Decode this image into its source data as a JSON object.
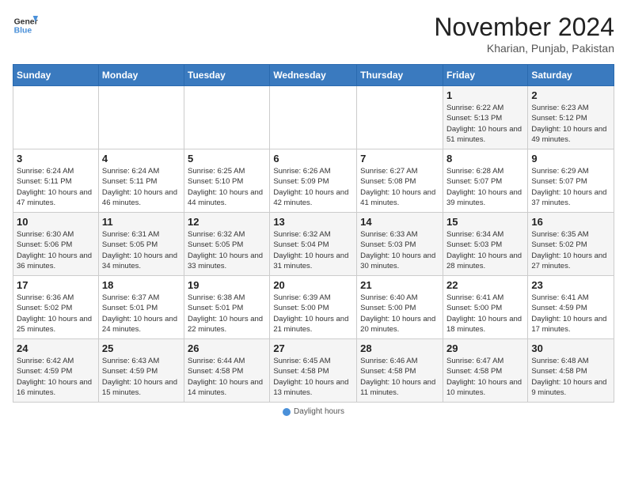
{
  "header": {
    "logo_line1": "General",
    "logo_line2": "Blue",
    "month_year": "November 2024",
    "location": "Kharian, Punjab, Pakistan"
  },
  "days_of_week": [
    "Sunday",
    "Monday",
    "Tuesday",
    "Wednesday",
    "Thursday",
    "Friday",
    "Saturday"
  ],
  "weeks": [
    [
      {
        "day": "",
        "info": ""
      },
      {
        "day": "",
        "info": ""
      },
      {
        "day": "",
        "info": ""
      },
      {
        "day": "",
        "info": ""
      },
      {
        "day": "",
        "info": ""
      },
      {
        "day": "1",
        "info": "Sunrise: 6:22 AM\nSunset: 5:13 PM\nDaylight: 10 hours and 51 minutes."
      },
      {
        "day": "2",
        "info": "Sunrise: 6:23 AM\nSunset: 5:12 PM\nDaylight: 10 hours and 49 minutes."
      }
    ],
    [
      {
        "day": "3",
        "info": "Sunrise: 6:24 AM\nSunset: 5:11 PM\nDaylight: 10 hours and 47 minutes."
      },
      {
        "day": "4",
        "info": "Sunrise: 6:24 AM\nSunset: 5:11 PM\nDaylight: 10 hours and 46 minutes."
      },
      {
        "day": "5",
        "info": "Sunrise: 6:25 AM\nSunset: 5:10 PM\nDaylight: 10 hours and 44 minutes."
      },
      {
        "day": "6",
        "info": "Sunrise: 6:26 AM\nSunset: 5:09 PM\nDaylight: 10 hours and 42 minutes."
      },
      {
        "day": "7",
        "info": "Sunrise: 6:27 AM\nSunset: 5:08 PM\nDaylight: 10 hours and 41 minutes."
      },
      {
        "day": "8",
        "info": "Sunrise: 6:28 AM\nSunset: 5:07 PM\nDaylight: 10 hours and 39 minutes."
      },
      {
        "day": "9",
        "info": "Sunrise: 6:29 AM\nSunset: 5:07 PM\nDaylight: 10 hours and 37 minutes."
      }
    ],
    [
      {
        "day": "10",
        "info": "Sunrise: 6:30 AM\nSunset: 5:06 PM\nDaylight: 10 hours and 36 minutes."
      },
      {
        "day": "11",
        "info": "Sunrise: 6:31 AM\nSunset: 5:05 PM\nDaylight: 10 hours and 34 minutes."
      },
      {
        "day": "12",
        "info": "Sunrise: 6:32 AM\nSunset: 5:05 PM\nDaylight: 10 hours and 33 minutes."
      },
      {
        "day": "13",
        "info": "Sunrise: 6:32 AM\nSunset: 5:04 PM\nDaylight: 10 hours and 31 minutes."
      },
      {
        "day": "14",
        "info": "Sunrise: 6:33 AM\nSunset: 5:03 PM\nDaylight: 10 hours and 30 minutes."
      },
      {
        "day": "15",
        "info": "Sunrise: 6:34 AM\nSunset: 5:03 PM\nDaylight: 10 hours and 28 minutes."
      },
      {
        "day": "16",
        "info": "Sunrise: 6:35 AM\nSunset: 5:02 PM\nDaylight: 10 hours and 27 minutes."
      }
    ],
    [
      {
        "day": "17",
        "info": "Sunrise: 6:36 AM\nSunset: 5:02 PM\nDaylight: 10 hours and 25 minutes."
      },
      {
        "day": "18",
        "info": "Sunrise: 6:37 AM\nSunset: 5:01 PM\nDaylight: 10 hours and 24 minutes."
      },
      {
        "day": "19",
        "info": "Sunrise: 6:38 AM\nSunset: 5:01 PM\nDaylight: 10 hours and 22 minutes."
      },
      {
        "day": "20",
        "info": "Sunrise: 6:39 AM\nSunset: 5:00 PM\nDaylight: 10 hours and 21 minutes."
      },
      {
        "day": "21",
        "info": "Sunrise: 6:40 AM\nSunset: 5:00 PM\nDaylight: 10 hours and 20 minutes."
      },
      {
        "day": "22",
        "info": "Sunrise: 6:41 AM\nSunset: 5:00 PM\nDaylight: 10 hours and 18 minutes."
      },
      {
        "day": "23",
        "info": "Sunrise: 6:41 AM\nSunset: 4:59 PM\nDaylight: 10 hours and 17 minutes."
      }
    ],
    [
      {
        "day": "24",
        "info": "Sunrise: 6:42 AM\nSunset: 4:59 PM\nDaylight: 10 hours and 16 minutes."
      },
      {
        "day": "25",
        "info": "Sunrise: 6:43 AM\nSunset: 4:59 PM\nDaylight: 10 hours and 15 minutes."
      },
      {
        "day": "26",
        "info": "Sunrise: 6:44 AM\nSunset: 4:58 PM\nDaylight: 10 hours and 14 minutes."
      },
      {
        "day": "27",
        "info": "Sunrise: 6:45 AM\nSunset: 4:58 PM\nDaylight: 10 hours and 13 minutes."
      },
      {
        "day": "28",
        "info": "Sunrise: 6:46 AM\nSunset: 4:58 PM\nDaylight: 10 hours and 11 minutes."
      },
      {
        "day": "29",
        "info": "Sunrise: 6:47 AM\nSunset: 4:58 PM\nDaylight: 10 hours and 10 minutes."
      },
      {
        "day": "30",
        "info": "Sunrise: 6:48 AM\nSunset: 4:58 PM\nDaylight: 10 hours and 9 minutes."
      }
    ]
  ],
  "footer": {
    "legend_label": "Daylight hours"
  }
}
